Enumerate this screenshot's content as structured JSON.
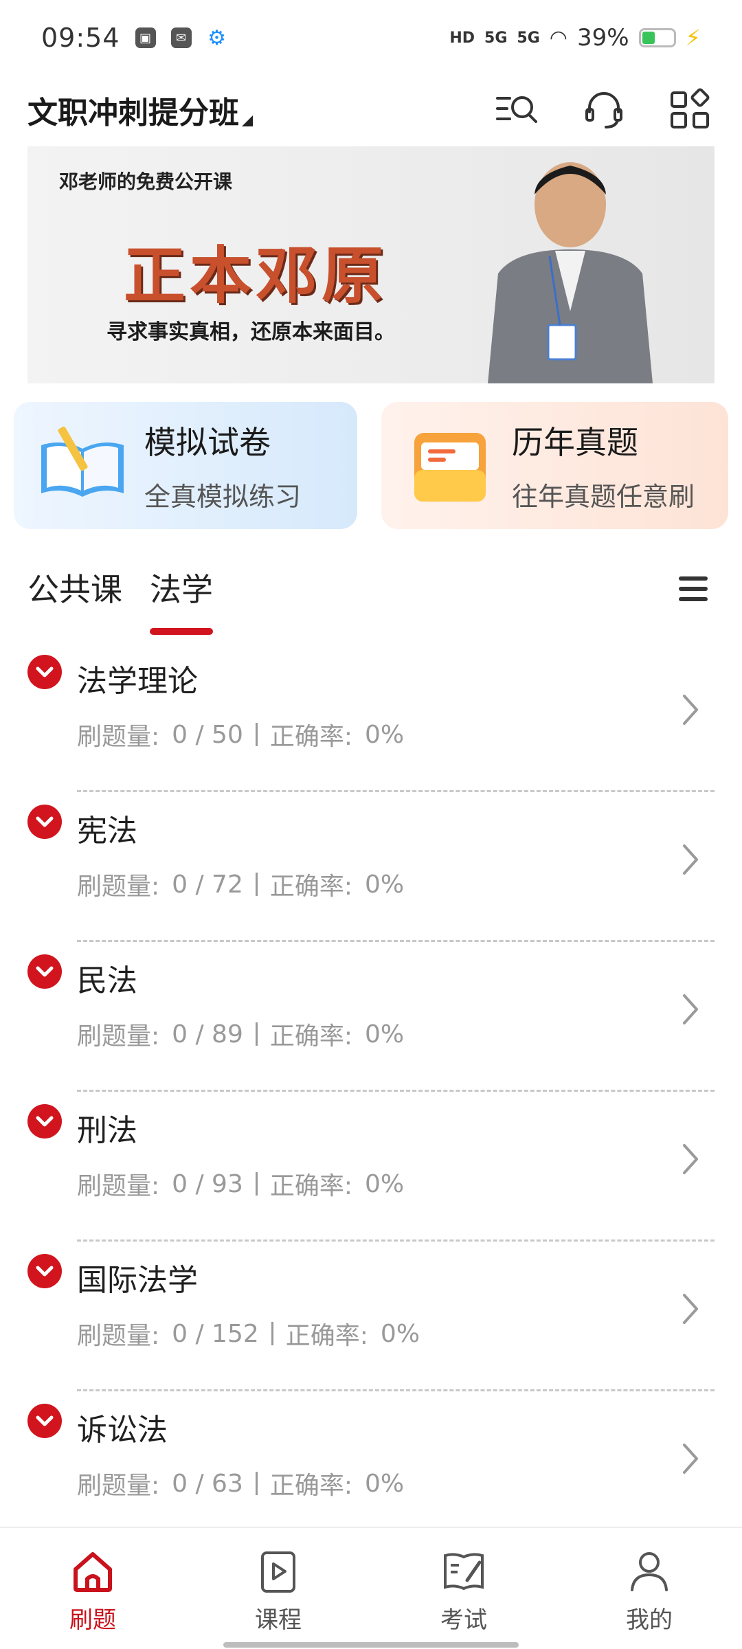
{
  "status_bar": {
    "time": "09:54",
    "signal1": "HD",
    "signal2": "5G",
    "signal3": "5G",
    "battery_percent": "39%"
  },
  "header": {
    "title": "文职冲刺提分班",
    "icons": [
      "search-list-icon",
      "customer-service-icon",
      "apps-grid-icon"
    ]
  },
  "banner": {
    "small_title": "邓老师的免费公开课",
    "big_title": "正本邓原",
    "slogan": "寻求事实真相，还原本来面目。"
  },
  "cards": {
    "mock": {
      "title": "模拟试卷",
      "subtitle": "全真模拟练习"
    },
    "past": {
      "title": "历年真题",
      "subtitle": "往年真题任意刷"
    }
  },
  "tabs": {
    "items": [
      "公共课",
      "法学"
    ],
    "active_index": 1
  },
  "list_labels": {
    "count_label": "刷题量:",
    "accuracy_label": "正确率:"
  },
  "subjects": [
    {
      "name": "法学理论",
      "count": "0 / 50",
      "accuracy": "0%"
    },
    {
      "name": "宪法",
      "count": "0 / 72",
      "accuracy": "0%"
    },
    {
      "name": "民法",
      "count": "0 / 89",
      "accuracy": "0%"
    },
    {
      "name": "刑法",
      "count": "0 / 93",
      "accuracy": "0%"
    },
    {
      "name": "国际法学",
      "count": "0 / 152",
      "accuracy": "0%"
    },
    {
      "name": "诉讼法",
      "count": "0 / 63",
      "accuracy": "0%"
    }
  ],
  "bottom_nav": {
    "items": [
      {
        "label": "刷题",
        "icon": "home-icon"
      },
      {
        "label": "课程",
        "icon": "play-video-icon"
      },
      {
        "label": "考试",
        "icon": "exam-book-icon"
      },
      {
        "label": "我的",
        "icon": "profile-icon"
      }
    ],
    "active_index": 0
  },
  "colors": {
    "accent": "#d1141d",
    "mock_card": "#d6e9fb",
    "past_card": "#fde3d6"
  }
}
